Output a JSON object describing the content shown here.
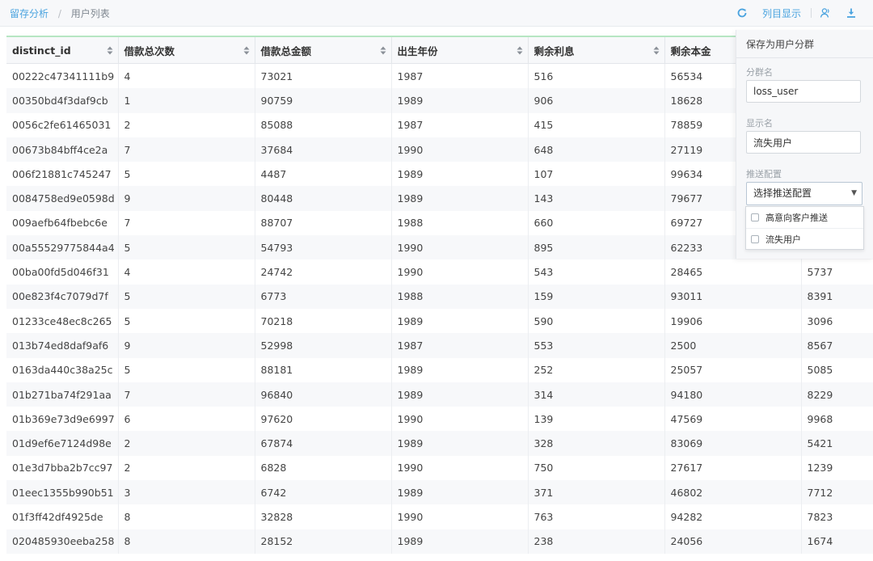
{
  "breadcrumb": {
    "parent": "留存分析",
    "separator": "/",
    "current": "用户列表"
  },
  "toolbar": {
    "refresh_icon": "refresh-icon",
    "column_display": "列目显示",
    "user_icon": "user-group-icon",
    "download_icon": "download-icon",
    "accent_color": "#4aa3df"
  },
  "table": {
    "columns": [
      "distinct_id",
      "借款总次数",
      "借款总金额",
      "出生年份",
      "剩余利息",
      "剩余本金",
      ""
    ],
    "rows": [
      [
        "00222c47341111b9",
        "4",
        "73021",
        "1987",
        "516",
        "56534",
        ""
      ],
      [
        "00350bd4f3daf9cb",
        "1",
        "90759",
        "1989",
        "906",
        "18628",
        ""
      ],
      [
        "0056c2fe61465031",
        "2",
        "85088",
        "1987",
        "415",
        "78859",
        ""
      ],
      [
        "00673b84bff4ce2a",
        "7",
        "37684",
        "1990",
        "648",
        "27119",
        ""
      ],
      [
        "006f21881c745247",
        "5",
        "4487",
        "1989",
        "107",
        "99634",
        ""
      ],
      [
        "0084758ed9e0598d",
        "9",
        "80448",
        "1989",
        "143",
        "79677",
        ""
      ],
      [
        "009aefb64fbebc6e",
        "7",
        "88707",
        "1988",
        "660",
        "69727",
        ""
      ],
      [
        "00a55529775844a4",
        "5",
        "54793",
        "1990",
        "895",
        "62233",
        ""
      ],
      [
        "00ba00fd5d046f31",
        "4",
        "24742",
        "1990",
        "543",
        "28465",
        "5737"
      ],
      [
        "00e823f4c7079d7f",
        "5",
        "6773",
        "1988",
        "159",
        "93011",
        "8391"
      ],
      [
        "01233ce48ec8c265",
        "5",
        "70218",
        "1989",
        "590",
        "19906",
        "3096"
      ],
      [
        "013b74ed8daf9af6",
        "9",
        "52998",
        "1987",
        "553",
        "2500",
        "8567"
      ],
      [
        "0163da440c38a25c",
        "5",
        "88181",
        "1989",
        "252",
        "25057",
        "5085"
      ],
      [
        "01b271ba74f291aa",
        "7",
        "96840",
        "1989",
        "314",
        "94180",
        "8229"
      ],
      [
        "01b369e73d9e6997",
        "6",
        "97620",
        "1990",
        "139",
        "47569",
        "9968"
      ],
      [
        "01d9ef6e7124d98e",
        "2",
        "67874",
        "1989",
        "328",
        "83069",
        "5421"
      ],
      [
        "01e3d7bba2b7cc97",
        "2",
        "6828",
        "1990",
        "750",
        "27617",
        "1239"
      ],
      [
        "01eec1355b990b51",
        "3",
        "6742",
        "1989",
        "371",
        "46802",
        "7712"
      ],
      [
        "01f3ff42df4925de",
        "8",
        "32828",
        "1990",
        "763",
        "94282",
        "7823"
      ],
      [
        "020485930eeba258",
        "8",
        "28152",
        "1989",
        "238",
        "24056",
        "1674"
      ]
    ]
  },
  "panel": {
    "title": "保存为用户分群",
    "group_name_label": "分群名",
    "group_name_value": "loss_user",
    "display_name_label": "显示名",
    "display_name_value": "流失用户",
    "push_label": "推送配置",
    "push_select_value": "选择推送配置",
    "push_options": [
      "高意向客户推送",
      "流失用户"
    ],
    "confirm_color": "#2fbd6a"
  }
}
